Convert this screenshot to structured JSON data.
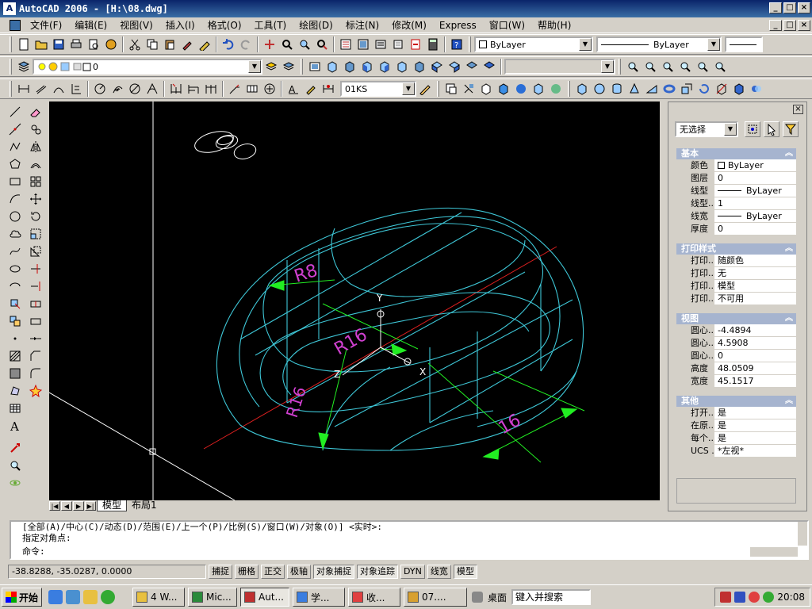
{
  "window": {
    "title": "AutoCAD 2006 - [H:\\08.dwg]",
    "min": "_",
    "max": "□",
    "close": "×"
  },
  "menu": [
    "文件(F)",
    "编辑(E)",
    "视图(V)",
    "插入(I)",
    "格式(O)",
    "工具(T)",
    "绘图(D)",
    "标注(N)",
    "修改(M)",
    "Express",
    "窗口(W)",
    "帮助(H)"
  ],
  "toolbar": {
    "color": "ByLayer",
    "linetype": "ByLayer",
    "layer": "0",
    "dimstyle": "01KS"
  },
  "drawing": {
    "dimensions": [
      "R8",
      "R16",
      "R16",
      "16"
    ],
    "ucs": {
      "x": "X",
      "y": "Y",
      "z": "Z"
    }
  },
  "tabs": {
    "model": "模型",
    "layout": "布局1"
  },
  "properties": {
    "selection": "无选择",
    "basic": {
      "title": "基本",
      "rows": [
        {
          "label": "颜色",
          "value": "ByLayer"
        },
        {
          "label": "图层",
          "value": "0"
        },
        {
          "label": "线型",
          "value": "ByLayer"
        },
        {
          "label": "线型...",
          "value": "1"
        },
        {
          "label": "线宽",
          "value": "ByLayer"
        },
        {
          "label": "厚度",
          "value": "0"
        }
      ]
    },
    "plot": {
      "title": "打印样式",
      "rows": [
        {
          "label": "打印...",
          "value": "随颜色"
        },
        {
          "label": "打印...",
          "value": "无"
        },
        {
          "label": "打印...",
          "value": "模型"
        },
        {
          "label": "打印...",
          "value": "不可用"
        }
      ]
    },
    "view": {
      "title": "视图",
      "rows": [
        {
          "label": "圆心...",
          "value": "-4.4894"
        },
        {
          "label": "圆心...",
          "value": "4.5908"
        },
        {
          "label": "圆心...",
          "value": "0"
        },
        {
          "label": "高度",
          "value": "48.0509"
        },
        {
          "label": "宽度",
          "value": "45.1517"
        }
      ]
    },
    "misc": {
      "title": "其他",
      "rows": [
        {
          "label": "打开...",
          "value": "是"
        },
        {
          "label": "在原...",
          "value": "是"
        },
        {
          "label": "每个...",
          "value": "是"
        },
        {
          "label": "UCS ...",
          "value": "*左视*"
        }
      ]
    }
  },
  "command": {
    "line1": "[全部(A)/中心(C)/动态(D)/范围(E)/上一个(P)/比例(S)/窗口(W)/对象(O)] <实时>:",
    "line2": "指定对角点:",
    "prompt": "命令:"
  },
  "status": {
    "coords": "-38.8288, -35.0287, 0.0000",
    "buttons": [
      {
        "label": "捕捉",
        "on": false
      },
      {
        "label": "栅格",
        "on": false
      },
      {
        "label": "正交",
        "on": false
      },
      {
        "label": "极轴",
        "on": false
      },
      {
        "label": "对象捕捉",
        "on": true
      },
      {
        "label": "对象追踪",
        "on": true
      },
      {
        "label": "DYN",
        "on": false
      },
      {
        "label": "线宽",
        "on": false
      },
      {
        "label": "模型",
        "on": true
      }
    ]
  },
  "taskbar": {
    "start": "开始",
    "tasks": [
      "4 W...",
      "Mic...",
      "Aut...",
      "学...",
      "收...",
      "07...."
    ],
    "desktop": "桌面",
    "search_placeholder": "键入并搜索",
    "time": "20:08"
  },
  "colors": {
    "model_lines": "#3ec6d6",
    "axis": "#e02020",
    "dim_arrow": "#22ee22",
    "dim_text": "#d040d0",
    "ucs": "#ffffff"
  }
}
